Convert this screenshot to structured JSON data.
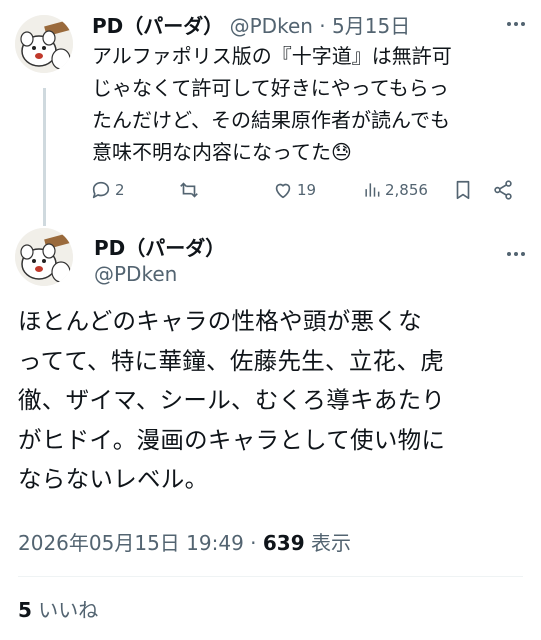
{
  "reply": {
    "name": "PD（パーダ）",
    "handle": "@PDken",
    "separator": "·",
    "date": "5月15日",
    "lines": [
      "アルファポリス版の『十字道』は無許可",
      "じゃなくて許可して好きにやってもらっ",
      "たんだけど、その結果原作者が読んでも",
      "意味不明な内容になってた😓"
    ],
    "actions": {
      "reply_count": "2",
      "retweet_count": "",
      "like_count": "19",
      "view_count": "2,856"
    }
  },
  "main": {
    "name": "PD（パーダ）",
    "handle": "@PDken",
    "lines": [
      "ほとんどのキャラの性格や頭が悪くな",
      "ってて、特に華鐘、佐藤先生、立花、虎",
      "徹、ザイマ、シール、むくろ導キあたり",
      "がヒドイ。漫画のキャラとして使い物に",
      "ならないレベル。"
    ],
    "timestamp": "2026年05月15日 19:49",
    "dot": "·",
    "views": "639",
    "views_label": "表示",
    "likes": "5",
    "likes_label": "いいね"
  },
  "icons": [
    "avatar-image",
    "more-icon",
    "reply-icon",
    "retweet-icon",
    "like-icon",
    "views-icon",
    "bookmark-icon",
    "share-icon"
  ],
  "colors": {
    "text": "#0f1419",
    "secondary": "#536471",
    "thread_line": "#cfd9de"
  }
}
